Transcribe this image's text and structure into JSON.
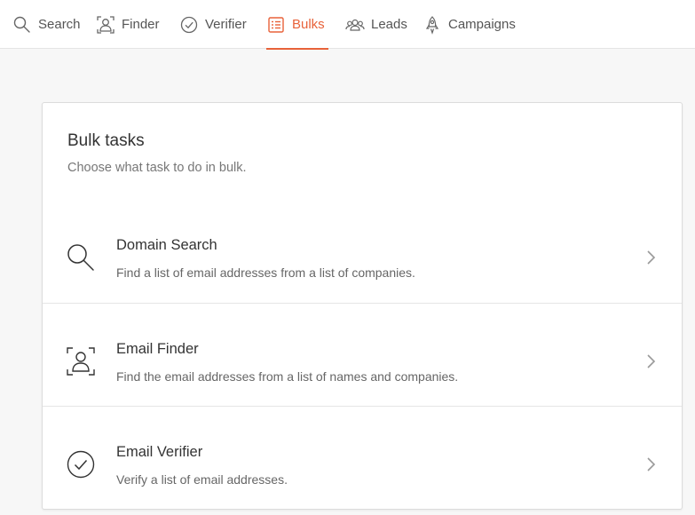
{
  "nav": {
    "items": [
      {
        "label": "Search",
        "icon": "search-icon",
        "active": false
      },
      {
        "label": "Finder",
        "icon": "person-frame-icon",
        "active": false
      },
      {
        "label": "Verifier",
        "icon": "check-circle-icon",
        "active": false
      },
      {
        "label": "Bulks",
        "icon": "list-icon",
        "active": true
      },
      {
        "label": "Leads",
        "icon": "people-icon",
        "active": false
      },
      {
        "label": "Campaigns",
        "icon": "rocket-icon",
        "active": false
      }
    ],
    "accent_color": "#e8623a"
  },
  "card": {
    "title": "Bulk tasks",
    "subtitle": "Choose what task to do in bulk.",
    "tasks": [
      {
        "title": "Domain Search",
        "description": "Find a list of email addresses from a list of companies.",
        "icon": "search-icon"
      },
      {
        "title": "Email Finder",
        "description": "Find the email addresses from a list of names and companies.",
        "icon": "person-frame-icon"
      },
      {
        "title": "Email Verifier",
        "description": "Verify a list of email addresses.",
        "icon": "check-circle-icon"
      }
    ]
  }
}
